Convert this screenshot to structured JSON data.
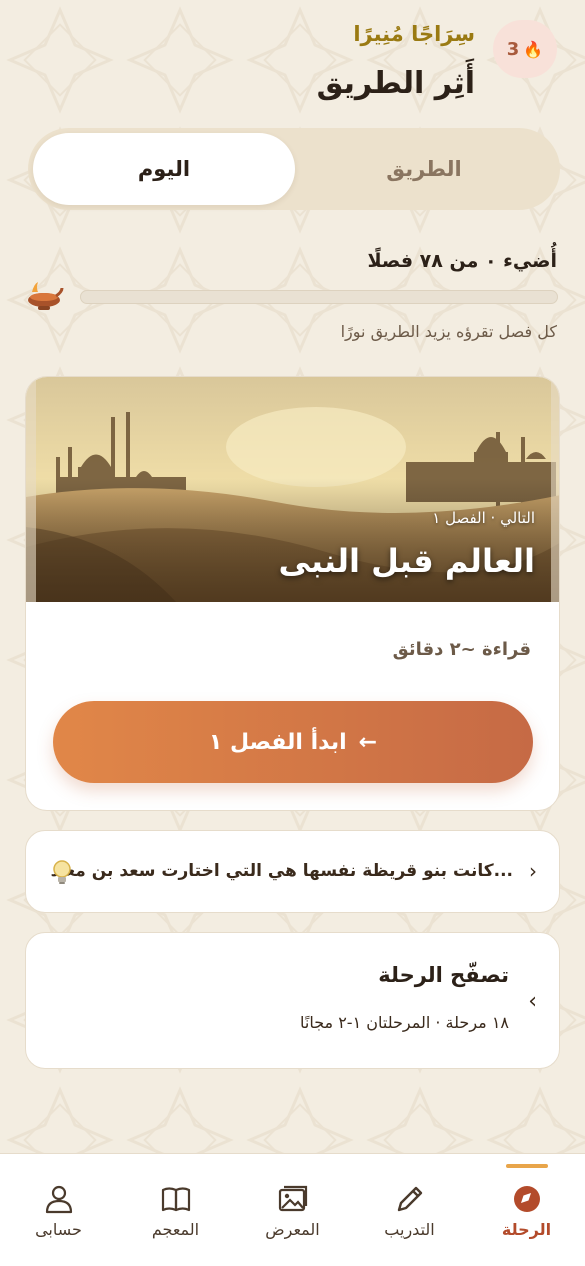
{
  "header": {
    "brand": "سِرَاجًا مُنِيرًا",
    "title": "أَثِر الطريق",
    "streak_count": "3",
    "streak_icon": "flame-icon"
  },
  "tabs": [
    {
      "label": "اليوم",
      "active": true
    },
    {
      "label": "الطريق",
      "active": false
    }
  ],
  "progress": {
    "title": "أُضيء ٠ من ٧٨ فصلًا",
    "lit": 0,
    "total": 78,
    "subtitle": "كل فصل تقرؤه يزيد الطريق نورًا",
    "icon": "oil-lamp-icon"
  },
  "chapter": {
    "meta": "التالي · الفصل ١",
    "title": "العالم قبل النبى",
    "reading_time": "قراءة ~٢ دقائق",
    "cta_label": "ابدأ الفصل ١",
    "cta_arrow": "←"
  },
  "fact": {
    "text": "كانت بنو قريظة نفسها هي التي اختارت سعد بن معاذ...",
    "chevron": "›",
    "icon": "lightbulb-icon"
  },
  "browse": {
    "title": "تصفّح الرحلة",
    "subtitle": "١٨ مرحلة · المرحلتان ١-٢ مجانًا",
    "chevron": "‹"
  },
  "nav": [
    {
      "label": "الرحلة",
      "icon": "compass-icon",
      "active": true
    },
    {
      "label": "التدريب",
      "icon": "pencil-icon",
      "active": false
    },
    {
      "label": "المعرض",
      "icon": "gallery-icon",
      "active": false
    },
    {
      "label": "المعجم",
      "icon": "book-icon",
      "active": false
    },
    {
      "label": "حسابى",
      "icon": "person-icon",
      "active": false
    }
  ],
  "colors": {
    "background": "#f3ede1",
    "accent": "#d8843f",
    "active_nav": "#b34b2b",
    "brand_gold": "#9a7a12"
  }
}
